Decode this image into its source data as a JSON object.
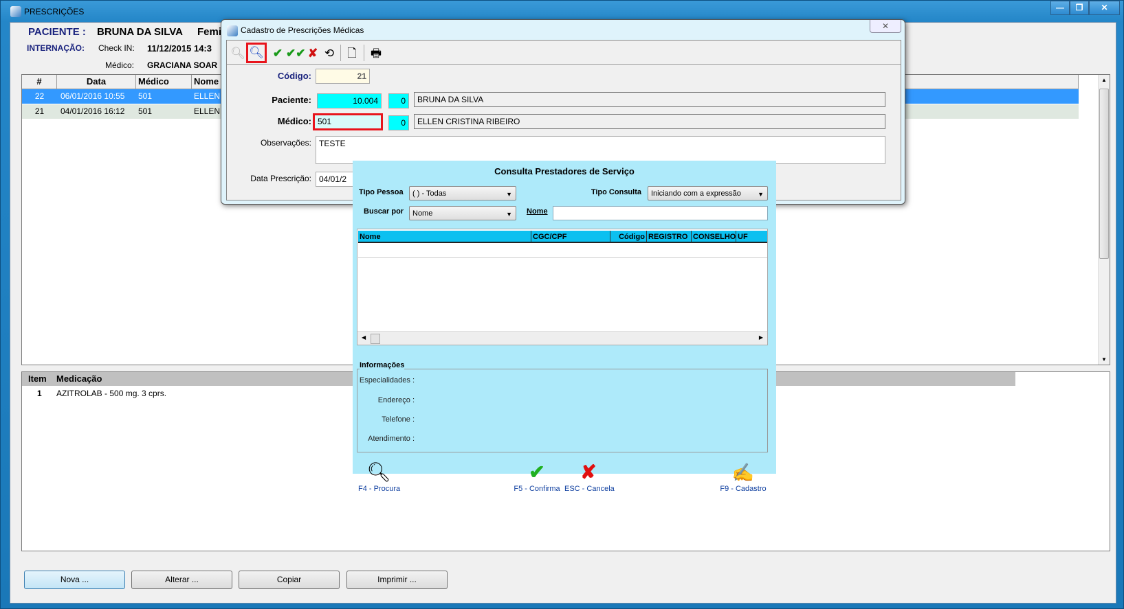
{
  "window": {
    "title": "PRESCRIÇÕES",
    "controls": [
      "—",
      "❐",
      "✕"
    ]
  },
  "header": {
    "patient_label": "PACIENTE :",
    "patient_name": "BRUNA DA SILVA",
    "patient_sex": "Femi",
    "internacao_label": "INTERNAÇÃO:",
    "checkin_label": "Check IN:",
    "checkin_value": "11/12/2015 14:3",
    "medico_label": "Médico:",
    "medico_value": "GRACIANA SOAR"
  },
  "prescriptions": {
    "columns": [
      "#",
      "Data",
      "Médico",
      "Nome"
    ],
    "rows": [
      {
        "num": "22",
        "data": "06/01/2016 10:55",
        "medico": "501",
        "nome": "ELLEN C",
        "selected": true
      },
      {
        "num": "21",
        "data": "04/01/2016 16:12",
        "medico": "501",
        "nome": "ELLEN C",
        "selected": false
      }
    ]
  },
  "medications": {
    "columns": [
      "Item",
      "Medicação"
    ],
    "rows": [
      {
        "item": "1",
        "medicacao": "AZITROLAB - 500 mg. 3 cprs."
      }
    ]
  },
  "buttons": {
    "nova": "Nova ...",
    "alterar": "Alterar ...",
    "copiar": "Copiar",
    "imprimir": "Imprimir ..."
  },
  "dialog": {
    "title": "Cadastro de Prescrições Médicas",
    "close": "✕",
    "toolbar": [
      "search-disabled",
      "search",
      "confirm",
      "confirm-all",
      "cancel",
      "history",
      "new-document",
      "print"
    ],
    "codigo_label": "Código:",
    "codigo_value": "21",
    "paciente_label": "Paciente:",
    "paciente_code": "10.004",
    "paciente_sub": "0",
    "paciente_name": "BRUNA DA SILVA",
    "medico_label": "Médico:",
    "medico_code": "501",
    "medico_sub": "0",
    "medico_name": "ELLEN CRISTINA RIBEIRO",
    "obs_label": "Observações:",
    "obs_value": "TESTE",
    "data_label": "Data Prescrição:",
    "data_value": "04/01/2"
  },
  "lookup": {
    "title": "Consulta Prestadores de Serviço",
    "tipo_pessoa_label": "Tipo Pessoa",
    "tipo_pessoa_value": "( ) - Todas",
    "tipo_consulta_label": "Tipo Consulta",
    "tipo_consulta_value": "Iniciando com a expressão",
    "buscar_label": "Buscar por",
    "buscar_value": "Nome",
    "nome_label": "Nome",
    "nome_value": "",
    "columns": [
      "Nome",
      "CGC/CPF",
      "Código",
      "REGISTRO",
      "CONSELHO",
      "UF"
    ],
    "info_label": "Informações",
    "info_fields": [
      "Especialidades :",
      "Endereço :",
      "Telefone :",
      "Atendimento :"
    ],
    "actions": {
      "procura": "F4 - Procura",
      "confirma": "F5 - Confirma",
      "cancela": "ESC - Cancela",
      "cadastro": "F9 - Cadastro"
    }
  },
  "colors": {
    "selected_row": "#3399ff",
    "lookup_bg": "#aeeafa",
    "grid_header": "#0cc0f0",
    "cyan_field": "#00ffff",
    "highlight": "#e8141c"
  }
}
